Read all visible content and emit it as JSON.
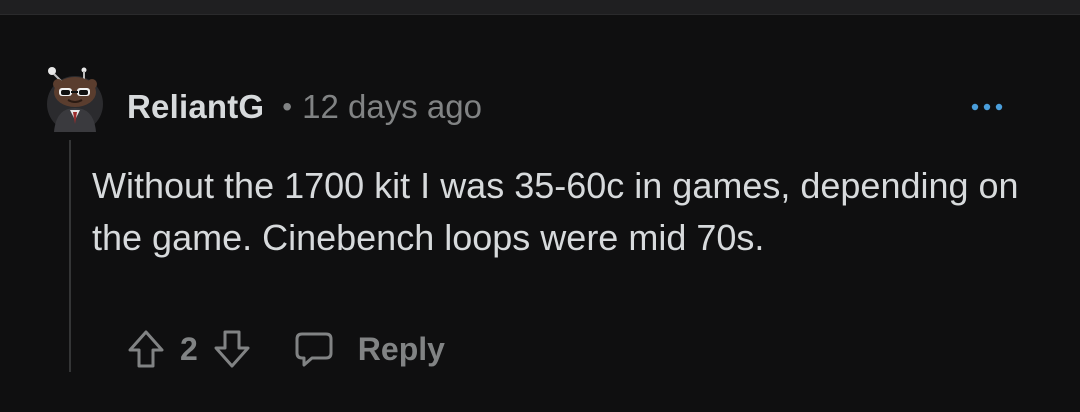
{
  "comment": {
    "author": "ReliantG",
    "separator": "•",
    "timestamp": "12 days ago",
    "body": "Without the 1700 kit I was 35-60c in games, depending on the game. Cinebench loops were mid 70s.",
    "score": "2",
    "reply_label": "Reply"
  },
  "icons": {
    "avatar": "snoo-avatar",
    "more": "more-options-icon",
    "upvote": "upvote-arrow-icon",
    "downvote": "downvote-arrow-icon",
    "reply": "comment-bubble-icon"
  },
  "colors": {
    "background": "#0f0f10",
    "text": "#d7dadc",
    "muted": "#818384",
    "accent": "#4a9edb",
    "thread_line": "#343536"
  }
}
